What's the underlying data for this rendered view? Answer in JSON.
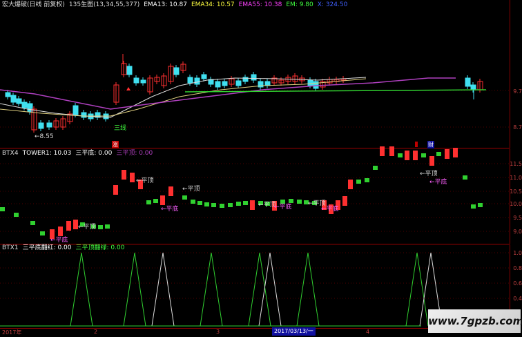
{
  "header_main": {
    "title": "宏大爆破(日线 前复权)",
    "ma_params": "135生图(13,34,55,377)",
    "ema13": "EMA13: 10.87",
    "ema34": "EMA34: 10.57",
    "ema55": "EMA55: 10.38",
    "em": "EM: 9.80",
    "extra": "X: 324.50"
  },
  "header_btx4": {
    "name": "BTX4",
    "tower": "TOWER1: 10.03",
    "sanpingdi": "三平底: 0.00",
    "sanpingding": "三平顶: 0.00"
  },
  "header_btx1": {
    "name": "BTX1",
    "sanpingdi_fanhong": "三平底翻红: 0.00",
    "sanpingding_fanlv": "三平顶翻绿: 0.00"
  },
  "main_ticks": [
    "9.7",
    "8.7"
  ],
  "btx4_ticks": [
    "11.5",
    "11.0",
    "10.5",
    "10.0",
    "9.5",
    "9.0"
  ],
  "btx1_ticks": [
    "1.0",
    "0.8",
    "0.6",
    "0.4"
  ],
  "labels": {
    "low_price": "8.55",
    "sanxian": "三线",
    "pingding": "平顶",
    "pingdi": "平底",
    "badge_red": "涨",
    "badge_blue": "财"
  },
  "footer": {
    "year": "2017年",
    "m2": "2",
    "m3": "3",
    "m4": "4",
    "current_date": "2017/03/13/一"
  },
  "watermark": "www.7gpzb.com",
  "colors": {
    "up": "#ff3030",
    "down": "#40e0f0",
    "green": "#30d030",
    "purple": "#b040c0",
    "pink": "#ff60ff"
  }
}
